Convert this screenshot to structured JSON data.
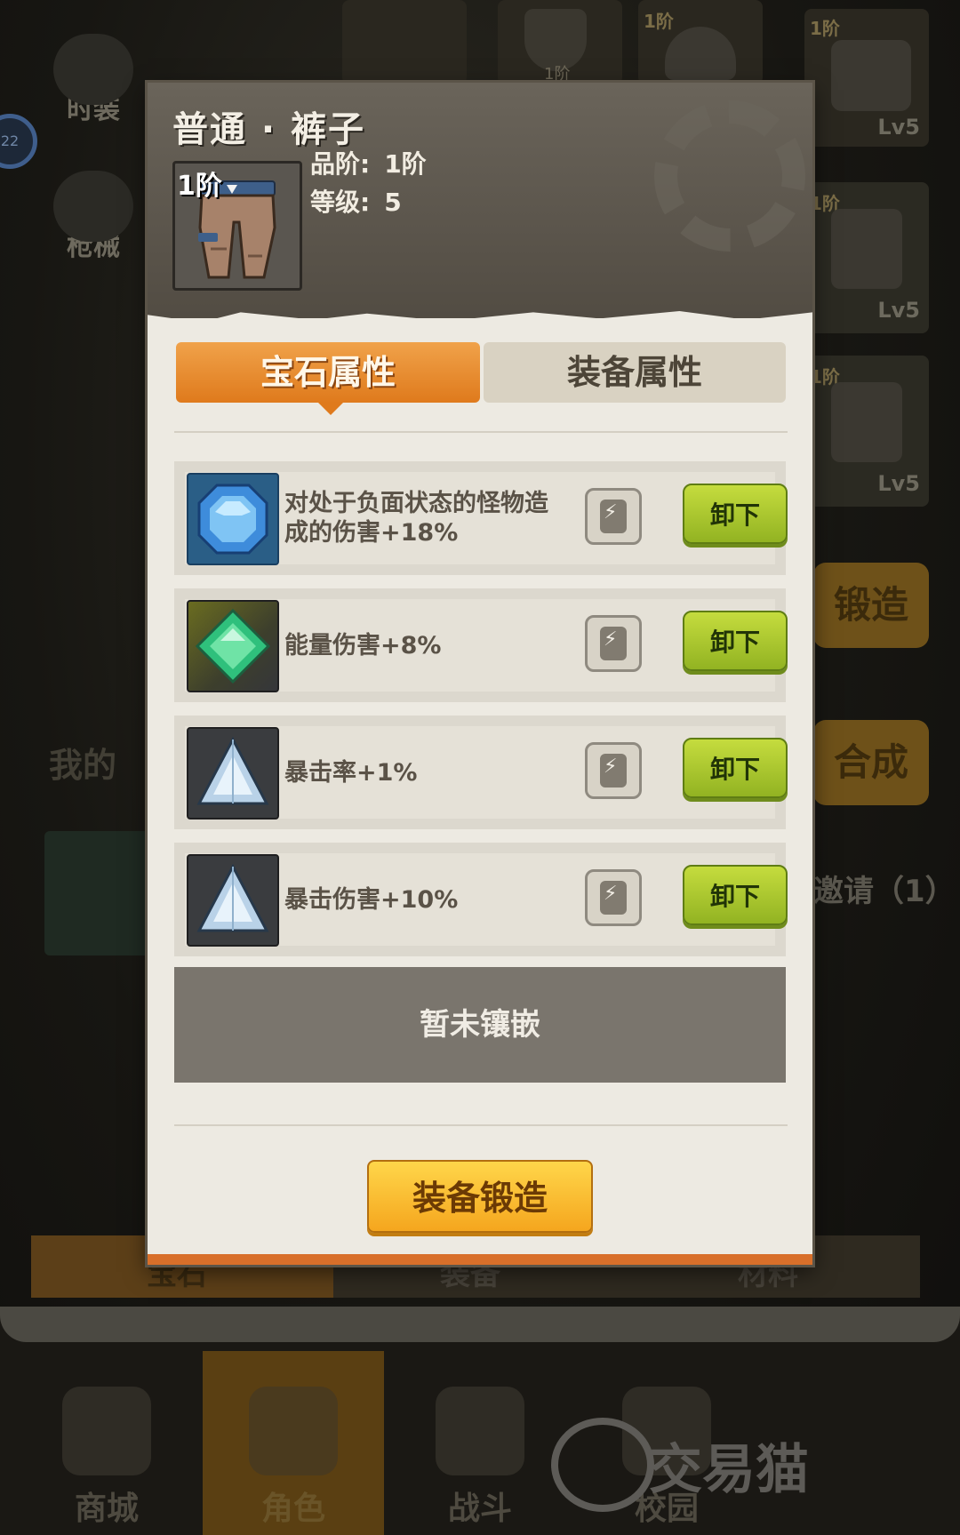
{
  "background": {
    "left_menu": [
      {
        "label": "时装",
        "icon": "costume-icon"
      },
      {
        "label": "枪械",
        "icon": "gun-icon"
      }
    ],
    "level_badge": "22",
    "top_slots": [
      {
        "label": "",
        "icon": "hero-portrait-icon"
      },
      {
        "label": "1阶",
        "icon": "shield-icon"
      },
      {
        "label": "1阶",
        "icon": "helmet-icon"
      },
      {
        "label": "1阶",
        "icon": "gloves-icon"
      }
    ],
    "right_slots": [
      {
        "tier": "1阶",
        "level": "Lv5",
        "icon": "gloves-icon"
      },
      {
        "tier": "1阶",
        "level": "Lv5",
        "icon": "pants-icon"
      },
      {
        "tier": "1阶",
        "level": "Lv5",
        "icon": "boots-icon"
      }
    ],
    "right_buttons": [
      "锻造",
      "合成"
    ],
    "invite": "邀请（1）",
    "mine_label": "我的",
    "bottom_tabs": [
      "宝石",
      "装备",
      "材料"
    ],
    "nav": [
      {
        "label": "商城",
        "icon": "shop-icon"
      },
      {
        "label": "角色",
        "icon": "character-icon"
      },
      {
        "label": "战斗",
        "icon": "battle-icon"
      },
      {
        "label": "校园",
        "icon": "campus-icon"
      }
    ],
    "watermark": "交易猫"
  },
  "item": {
    "title": "普通 · 裤子",
    "tier_badge": "1阶",
    "stats": [
      {
        "label": "品阶:",
        "value": "1阶"
      },
      {
        "label": "等级:",
        "value": "5"
      }
    ]
  },
  "tabs": {
    "gem": "宝石属性",
    "equip": "装备属性",
    "active": "gem"
  },
  "gems": [
    {
      "icon": "blue-octagon-gem-icon",
      "text": "对处于负面状态的怪物造成的伤害+18%",
      "unload": "卸下"
    },
    {
      "icon": "green-diamond-gem-icon",
      "text": "能量伤害+8%",
      "unload": "卸下"
    },
    {
      "icon": "white-triangle-gem-icon",
      "text": "暴击率+1%",
      "unload": "卸下"
    },
    {
      "icon": "white-triangle-gem-icon",
      "text": "暴击伤害+10%",
      "unload": "卸下"
    }
  ],
  "empty_slot": "暂未镶嵌",
  "forge_button": "装备锻造",
  "colors": {
    "tab_active": "#df7a1c",
    "unload_button": "#a8c52c",
    "forge_button": "#f7b82a",
    "panel_header": "#5d574e"
  }
}
